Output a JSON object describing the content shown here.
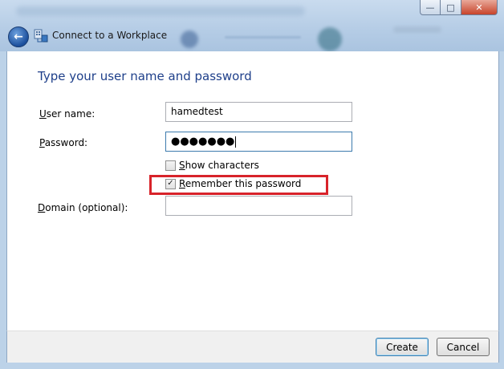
{
  "window": {
    "title": "Connect to a Workplace",
    "minimize_glyph": "—",
    "maximize_glyph": "□",
    "close_glyph": "✕"
  },
  "nav": {
    "back_glyph": "←",
    "title": "Connect to a Workplace"
  },
  "main": {
    "heading": "Type your user name and password",
    "username_label_key": "U",
    "username_label_rest": "ser name:",
    "username_value": "hamedtest",
    "password_label_key": "P",
    "password_label_rest": "assword:",
    "password_value": "●●●●●●●",
    "show_characters_key": "S",
    "show_characters_rest": "how characters",
    "show_characters_checked": false,
    "remember_key": "R",
    "remember_rest": "emember this password",
    "remember_checked": true,
    "remember_check_glyph": "✓",
    "domain_label_key": "D",
    "domain_label_rest": "omain (optional):",
    "domain_value": ""
  },
  "footer": {
    "create_label": "Create",
    "cancel_label": "Cancel"
  },
  "colors": {
    "heading": "#1e3f8a",
    "highlight": "#d8232a",
    "frame": "#bcd2e8"
  }
}
